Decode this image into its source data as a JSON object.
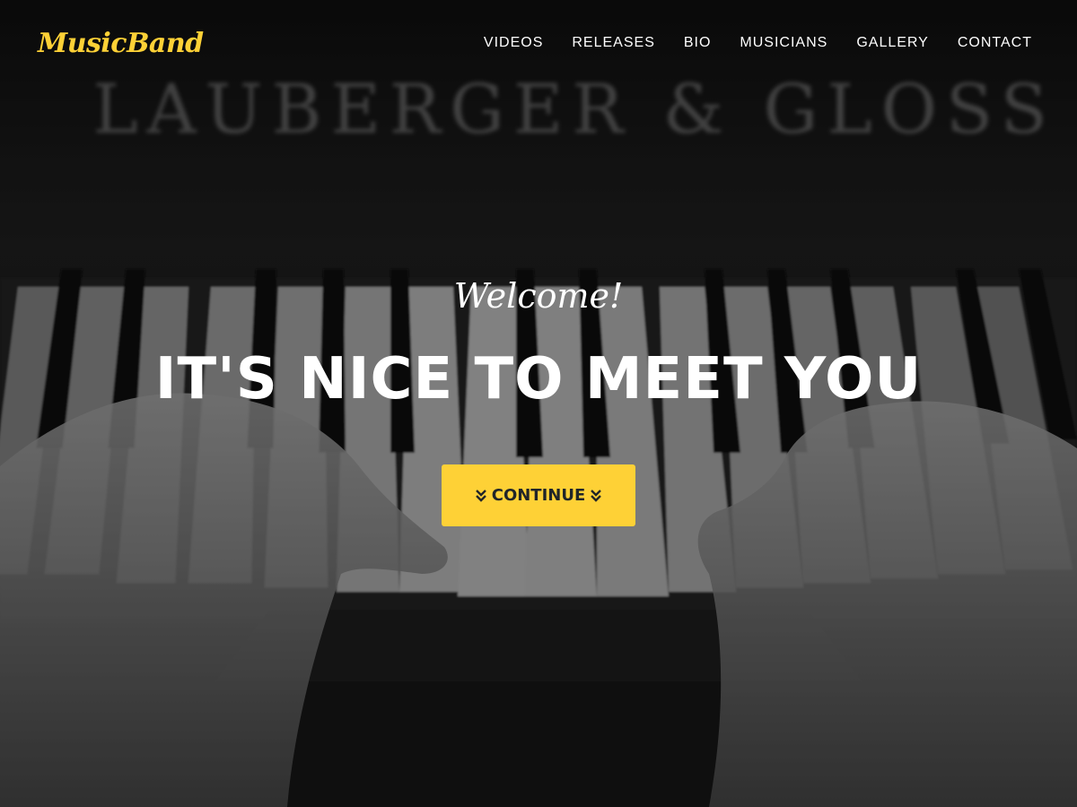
{
  "brand": {
    "name": "MusicBand",
    "color": "#fed136"
  },
  "nav": {
    "items": [
      {
        "label": "VIDEOS"
      },
      {
        "label": "RELEASES"
      },
      {
        "label": "BIO"
      },
      {
        "label": "MUSICIANS"
      },
      {
        "label": "GALLERY"
      },
      {
        "label": "CONTACT"
      }
    ]
  },
  "hero": {
    "background_sign": "LAUBERGER & GLOSS",
    "lead_in": "Welcome!",
    "heading": "IT'S NICE TO MEET YOU",
    "cta_label": "CONTINUE",
    "cta_icon": "chevrons-down-icon",
    "cta_color": "#fed136"
  }
}
